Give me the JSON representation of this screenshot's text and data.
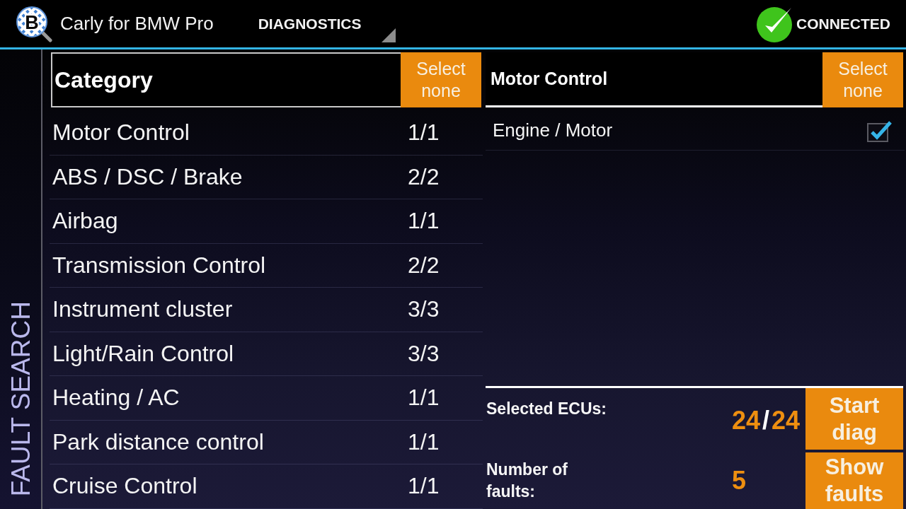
{
  "app_bar": {
    "logo_letter": "B",
    "title": "Carly for BMW Pro",
    "section": "DIAGNOSTICS",
    "status": "CONNECTED",
    "connected": true
  },
  "side_tab": {
    "label": "FAULT SEARCH"
  },
  "category_panel": {
    "heading": "Category",
    "button": "Select none",
    "rows": [
      {
        "name": "Motor Control",
        "count": "1/1"
      },
      {
        "name": "ABS / DSC / Brake",
        "count": "2/2"
      },
      {
        "name": "Airbag",
        "count": "1/1"
      },
      {
        "name": "Transmission Control",
        "count": "2/2"
      },
      {
        "name": "Instrument cluster",
        "count": "3/3"
      },
      {
        "name": "Light/Rain Control",
        "count": "3/3"
      },
      {
        "name": "Heating / AC",
        "count": "1/1"
      },
      {
        "name": "Park distance control",
        "count": "1/1"
      },
      {
        "name": "Cruise Control",
        "count": "1/1"
      }
    ]
  },
  "ecu_panel": {
    "heading": "Motor Control",
    "button": "Select none",
    "items": [
      {
        "name": "Engine / Motor",
        "checked": true
      }
    ]
  },
  "summary": {
    "selected_label": "Selected ECUs:",
    "ecu_count": {
      "selected": "24",
      "separator": "/",
      "total": "24"
    },
    "start_button": "Start diag",
    "faults_label": "Number of faults:",
    "fault_count": "5",
    "faults_button": "Show faults"
  }
}
